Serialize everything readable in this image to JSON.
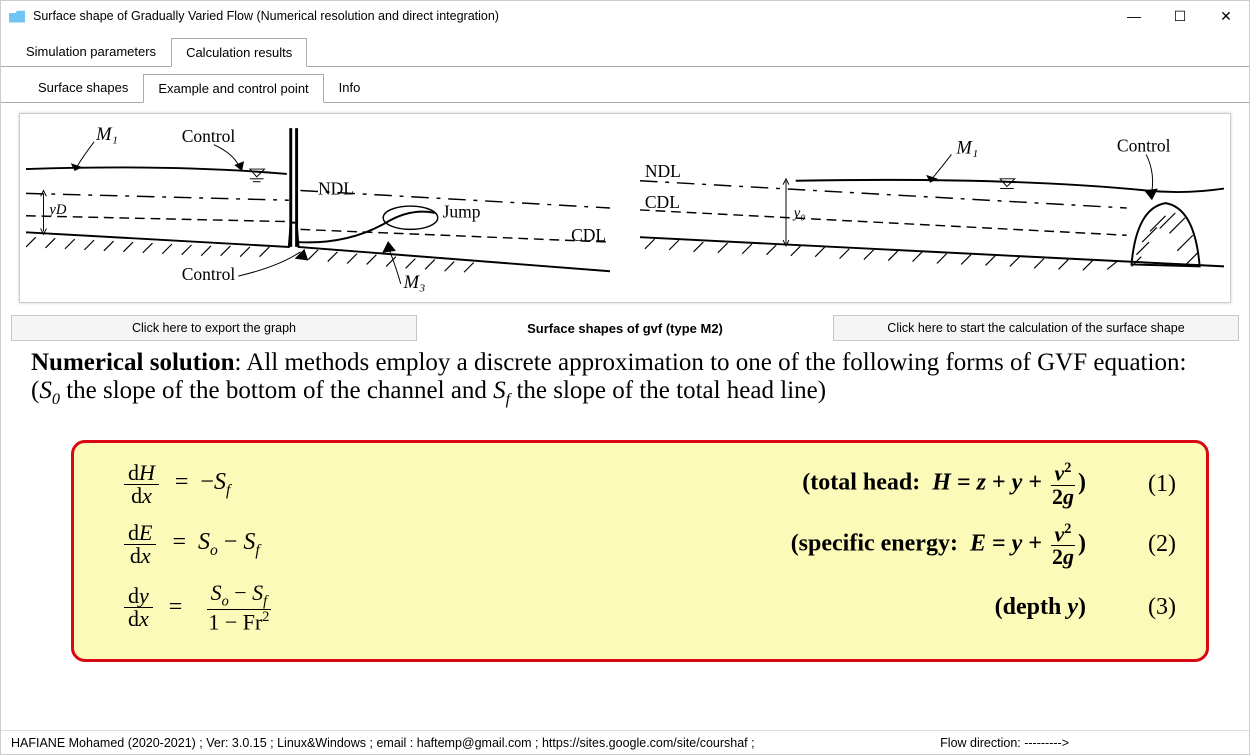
{
  "window": {
    "title": "Surface shape of Gradually Varied Flow (Numerical resolution and direct integration)"
  },
  "tabs_main": [
    {
      "label": "Simulation parameters"
    },
    {
      "label": "Calculation results"
    }
  ],
  "tabs_main_selected": 1,
  "tabs_sub": [
    {
      "label": "Surface shapes"
    },
    {
      "label": "Example and control point"
    },
    {
      "label": "Info"
    }
  ],
  "tabs_sub_selected": 1,
  "diagram": {
    "left": {
      "labels": {
        "m1": "M₁",
        "control_top": "Control",
        "ndl": "NDL",
        "jump": "Jump",
        "cdl": "CDL",
        "control_bottom": "Control",
        "m3": "M₃",
        "yd": "yD"
      }
    },
    "right": {
      "labels": {
        "ndl": "NDL",
        "cdl": "CDL",
        "m1": "M₁",
        "control": "Control",
        "yo": "y₀"
      }
    }
  },
  "actions": {
    "export_label": "Click here to export the graph",
    "center_label": "Surface shapes of gvf (type M2)",
    "calc_label": "Click here to start the calculation of the surface shape"
  },
  "solution": {
    "lead": "Numerical solution",
    "body": ": All methods employ a discrete approximation to one of the following forms of GVF equation: (S₀ the slope of the bottom of the channel and S_f the slope of the total head line)"
  },
  "equations": [
    {
      "lhs_num": "dH",
      "lhs_den": "dx",
      "rhs": " = −S_f",
      "desc": "(total head:  H = z + y + v²/2g)",
      "num": "(1)"
    },
    {
      "lhs_num": "dE",
      "lhs_den": "dx",
      "rhs": " = Sₒ − S_f",
      "desc": "(specific energy:  E = y + v²/2g)",
      "num": "(2)"
    },
    {
      "lhs_num": "dy",
      "lhs_den": "dx",
      "rhs_frac_num": "Sₒ − S_f",
      "rhs_frac_den": "1 − Fr²",
      "desc": "(depth y)",
      "num": "(3)"
    }
  ],
  "status": {
    "left": "HAFIANE Mohamed (2020-2021) ; Ver: 3.0.15 ; Linux&Windows ; email : haftemp@gmail.com ; https://sites.google.com/site/courshaf       ;",
    "flow": "Flow direction: --------->"
  }
}
